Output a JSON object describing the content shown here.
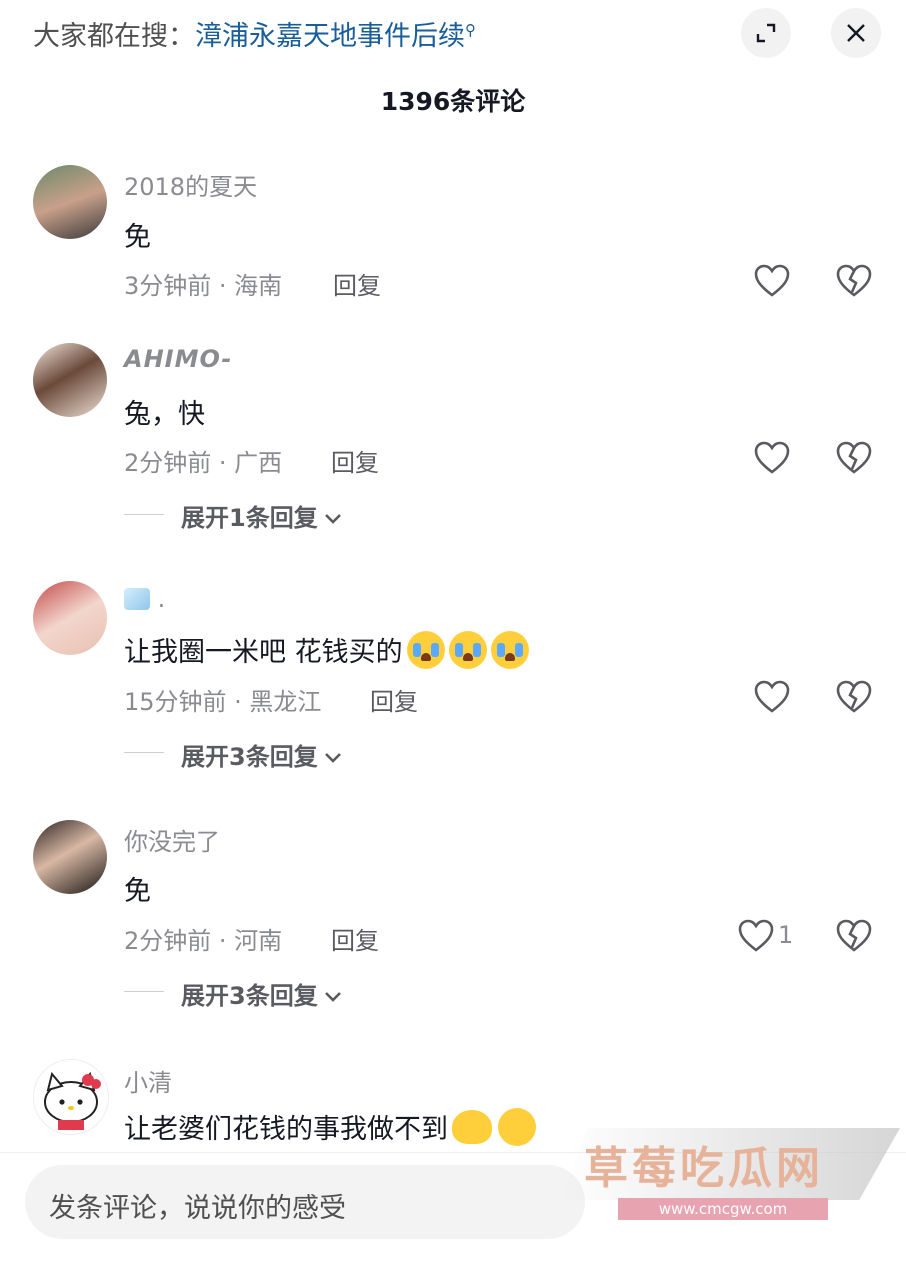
{
  "header": {
    "search_prefix": "大家都在搜：",
    "search_keyword": "漳浦永嘉天地事件后续",
    "comment_count": "1396条评论"
  },
  "comments": [
    {
      "username": "2018的夏天",
      "text": "免",
      "time_location": "3分钟前 · 海南",
      "reply": "回复",
      "likes": ""
    },
    {
      "username": "AHIMO-",
      "text": "兔，快",
      "time_location": "2分钟前 · 广西",
      "reply": "回复",
      "likes": "",
      "expand": "展开1条回复"
    },
    {
      "username": ".",
      "username_icon": "ice-cube-icon",
      "text": "让我圈一米吧 花钱买的",
      "text_emojis": [
        "crying-face-icon",
        "crying-face-icon",
        "crying-face-icon"
      ],
      "time_location": "15分钟前 · 黑龙江",
      "reply": "回复",
      "likes": "",
      "expand": "展开3条回复"
    },
    {
      "username": "你没完了",
      "text": "免",
      "time_location": "2分钟前 · 河南",
      "reply": "回复",
      "likes": "1",
      "expand": "展开3条回复"
    },
    {
      "username": "小清",
      "text": "让老婆们花钱的事我做不到",
      "text_emojis": [
        "heart-hands-icon",
        "hugging-face-icon"
      ]
    }
  ],
  "input": {
    "placeholder": "发条评论，说说你的感受"
  },
  "watermark": {
    "text": "草莓吃瓜网",
    "url": "www.cmcgw.com"
  },
  "colors": {
    "keyword": "#1a5e99",
    "text": "#161823",
    "muted": "#8a8b91"
  }
}
